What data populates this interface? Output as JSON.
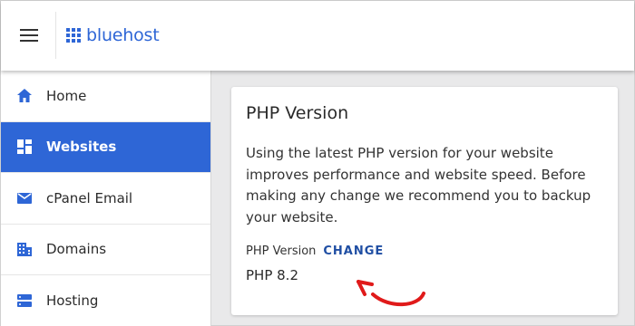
{
  "header": {
    "logo_text": "bluehost",
    "brand_color": "#2e66d6"
  },
  "sidebar": {
    "items": [
      {
        "label": "Home",
        "icon": "home-icon",
        "active": false
      },
      {
        "label": "Websites",
        "icon": "dashboard-icon",
        "active": true
      },
      {
        "label": "cPanel Email",
        "icon": "mail-icon",
        "active": false
      },
      {
        "label": "Domains",
        "icon": "building-icon",
        "active": false
      },
      {
        "label": "Hosting",
        "icon": "server-icon",
        "active": false
      }
    ]
  },
  "card": {
    "title": "PHP Version",
    "description": "Using the latest PHP version for your website improves performance and website speed. Before making any change we recommend you to backup your website.",
    "version_label": "PHP Version",
    "change_label": "CHANGE",
    "version_value": "PHP 8.2"
  },
  "colors": {
    "accent": "#2e66d6",
    "link": "#1f4ea3",
    "annotation": "#e01a1a"
  }
}
